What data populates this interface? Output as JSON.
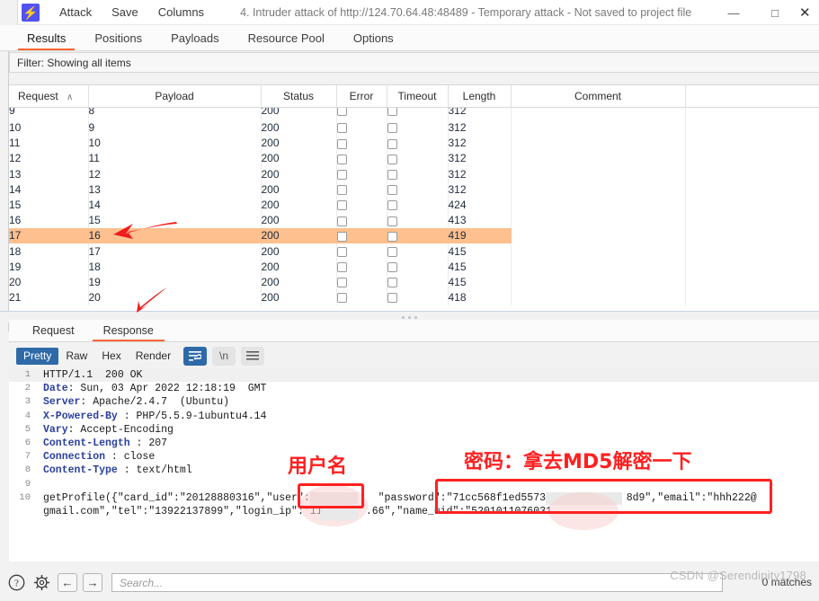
{
  "window": {
    "logo_glyph": "⚡",
    "menus": [
      "Attack",
      "Save",
      "Columns"
    ],
    "title": "4. Intruder attack of http://124.70.64.48:48489 - Temporary attack - Not saved to project file",
    "minimize": "—",
    "maximize": "□",
    "close": "✕"
  },
  "tabs": [
    {
      "label": "Results",
      "active": true
    },
    {
      "label": "Positions",
      "active": false
    },
    {
      "label": "Payloads",
      "active": false
    },
    {
      "label": "Resource Pool",
      "active": false
    },
    {
      "label": "Options",
      "active": false
    }
  ],
  "filter": {
    "text": "Filter: Showing all items"
  },
  "results_table": {
    "columns": [
      "Request",
      "Payload",
      "Status",
      "Error",
      "Timeout",
      "Length",
      "Comment"
    ],
    "sort_indicator": "∧",
    "sorted_column": "Request",
    "selected_request": "17",
    "rows": [
      {
        "request": "9",
        "payload": "8",
        "status": "200",
        "error": false,
        "timeout": false,
        "length": "312",
        "comment": "",
        "selected": false,
        "clipped": true
      },
      {
        "request": "10",
        "payload": "9",
        "status": "200",
        "error": false,
        "timeout": false,
        "length": "312",
        "comment": "",
        "selected": false
      },
      {
        "request": "11",
        "payload": "10",
        "status": "200",
        "error": false,
        "timeout": false,
        "length": "312",
        "comment": "",
        "selected": false
      },
      {
        "request": "12",
        "payload": "11",
        "status": "200",
        "error": false,
        "timeout": false,
        "length": "312",
        "comment": "",
        "selected": false
      },
      {
        "request": "13",
        "payload": "12",
        "status": "200",
        "error": false,
        "timeout": false,
        "length": "312",
        "comment": "",
        "selected": false
      },
      {
        "request": "14",
        "payload": "13",
        "status": "200",
        "error": false,
        "timeout": false,
        "length": "312",
        "comment": "",
        "selected": false
      },
      {
        "request": "15",
        "payload": "14",
        "status": "200",
        "error": false,
        "timeout": false,
        "length": "424",
        "comment": "",
        "selected": false
      },
      {
        "request": "16",
        "payload": "15",
        "status": "200",
        "error": false,
        "timeout": false,
        "length": "413",
        "comment": "",
        "selected": false
      },
      {
        "request": "17",
        "payload": "16",
        "status": "200",
        "error": false,
        "timeout": false,
        "length": "419",
        "comment": "",
        "selected": true
      },
      {
        "request": "18",
        "payload": "17",
        "status": "200",
        "error": false,
        "timeout": false,
        "length": "415",
        "comment": "",
        "selected": false
      },
      {
        "request": "19",
        "payload": "18",
        "status": "200",
        "error": false,
        "timeout": false,
        "length": "415",
        "comment": "",
        "selected": false
      },
      {
        "request": "20",
        "payload": "19",
        "status": "200",
        "error": false,
        "timeout": false,
        "length": "415",
        "comment": "",
        "selected": false
      },
      {
        "request": "21",
        "payload": "20",
        "status": "200",
        "error": false,
        "timeout": false,
        "length": "418",
        "comment": "",
        "selected": false
      }
    ]
  },
  "message_tabs": [
    {
      "label": "Request",
      "active": false
    },
    {
      "label": "Response",
      "active": true
    }
  ],
  "viewer_toolbar": {
    "modes": [
      {
        "label": "Pretty",
        "active": true
      },
      {
        "label": "Raw",
        "active": false
      },
      {
        "label": "Hex",
        "active": false
      },
      {
        "label": "Render",
        "active": false
      }
    ],
    "wrap_icon": "wordwrap-icon",
    "newline_label": "\\n",
    "menu_icon": "hamburger-icon"
  },
  "response": {
    "lines": [
      {
        "no": "1",
        "name": "",
        "rest": "HTTP/1.1  200 OK",
        "highlight": true
      },
      {
        "no": "2",
        "name": "Date",
        "rest": ": Sun, 03 Apr 2022 12:18:19  GMT"
      },
      {
        "no": "3",
        "name": "Server",
        "rest": ": Apache/2.4.7  (Ubuntu)"
      },
      {
        "no": "4",
        "name": "X-Powered-By",
        "rest": " : PHP/5.5.9-1ubuntu4.14"
      },
      {
        "no": "5",
        "name": "Vary",
        "rest": ": Accept-Encoding"
      },
      {
        "no": "6",
        "name": "Content-Length",
        "rest": " : 207"
      },
      {
        "no": "7",
        "name": "Connection",
        "rest": " : close"
      },
      {
        "no": "8",
        "name": "Content-Type",
        "rest": " : text/html"
      },
      {
        "no": "9",
        "name": "",
        "rest": ""
      },
      {
        "no": "10",
        "name": "",
        "rest": "getProfile({\"card_id\":\"20128880316\",\"user\":\"m2        \"password\":\"71cc568f1ed55738            8d9\",\"email\":\"hhh222@"
      },
      {
        "no": "",
        "name": "",
        "rest": "gmail.com\",\"tel\":\"13922137899\",\"login_ip\":\"110      .66\",\"name_uid\":\"5201011076031"
      }
    ]
  },
  "annotations": {
    "username_label": "用户名",
    "password_label": "密码：拿去MD5解密一下"
  },
  "statusbar": {
    "help_icon": "question-circle-icon",
    "settings_icon": "gear-icon",
    "back_icon": "←",
    "forward_icon": "→",
    "search_placeholder": "Search...",
    "search_value": "",
    "matches": "0 matches",
    "watermark": "CSDN @Serendipity1798"
  }
}
